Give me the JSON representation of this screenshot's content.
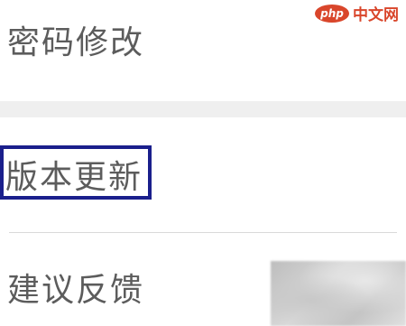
{
  "settings": {
    "items": [
      {
        "label": "密码修改"
      },
      {
        "label": "版本更新"
      },
      {
        "label": "建议反馈"
      }
    ]
  },
  "watermark": {
    "logo": "php",
    "text": "中文网"
  },
  "colors": {
    "highlight_border": "#1a1f8c",
    "label_text": "#5c5c5c",
    "section_gap": "#efefef",
    "watermark": "#d9462b"
  }
}
